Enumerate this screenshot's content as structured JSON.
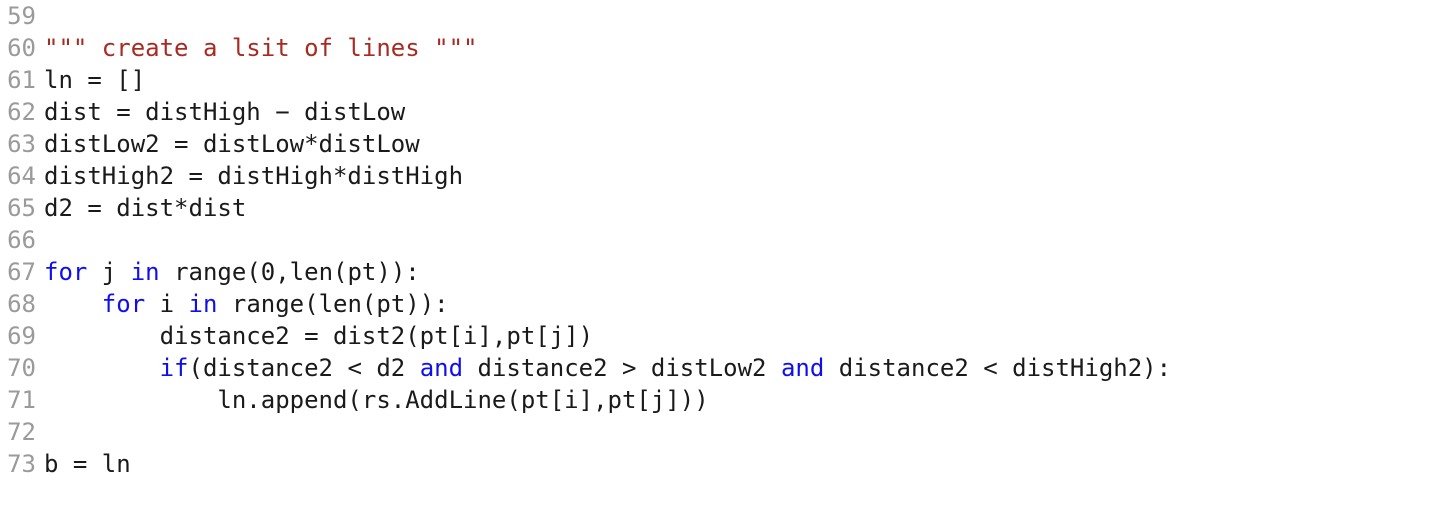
{
  "editor": {
    "language": "Python",
    "background_color": "#ffffff",
    "gutter_color": "#9a9a9a",
    "default_text_color": "#1a1a1a",
    "keyword_color": "#0f0fee",
    "string_color": "#a82b22",
    "font_size_px": 24,
    "line_height_px": 32,
    "first_visible_line": 59,
    "last_visible_line": 73,
    "clipped_top_fragment": "n"
  },
  "lines": [
    {
      "number": "59",
      "text": "",
      "tokens": []
    },
    {
      "number": "60",
      "text": "\"\"\" create a lsit of lines \"\"\"",
      "tokens": [
        {
          "t": "\"\"\" create a lsit of lines \"\"\"",
          "c": "str"
        }
      ]
    },
    {
      "number": "61",
      "text": "ln = []",
      "tokens": [
        {
          "t": "ln = []",
          "c": "plain"
        }
      ]
    },
    {
      "number": "62",
      "text": "dist = distHigh − distLow",
      "tokens": [
        {
          "t": "dist = distHigh − distLow",
          "c": "plain"
        }
      ]
    },
    {
      "number": "63",
      "text": "distLow2 = distLow*distLow",
      "tokens": [
        {
          "t": "distLow2 = distLow*distLow",
          "c": "plain"
        }
      ]
    },
    {
      "number": "64",
      "text": "distHigh2 = distHigh*distHigh",
      "tokens": [
        {
          "t": "distHigh2 = distHigh*distHigh",
          "c": "plain"
        }
      ]
    },
    {
      "number": "65",
      "text": "d2 = dist*dist",
      "tokens": [
        {
          "t": "d2 = dist*dist",
          "c": "plain"
        }
      ]
    },
    {
      "number": "66",
      "text": "",
      "tokens": []
    },
    {
      "number": "67",
      "text": "for j in range(0,len(pt)):",
      "tokens": [
        {
          "t": "for",
          "c": "kw"
        },
        {
          "t": " j ",
          "c": "plain"
        },
        {
          "t": "in",
          "c": "kw"
        },
        {
          "t": " range(0,len(pt)):",
          "c": "plain"
        }
      ]
    },
    {
      "number": "68",
      "text": "    for i in range(len(pt)):",
      "tokens": [
        {
          "t": "    ",
          "c": "plain"
        },
        {
          "t": "for",
          "c": "kw"
        },
        {
          "t": " i ",
          "c": "plain"
        },
        {
          "t": "in",
          "c": "kw"
        },
        {
          "t": " range(len(pt)):",
          "c": "plain"
        }
      ]
    },
    {
      "number": "69",
      "text": "        distance2 = dist2(pt[i],pt[j])",
      "tokens": [
        {
          "t": "        distance2 = dist2(pt[i],pt[j])",
          "c": "plain"
        }
      ]
    },
    {
      "number": "70",
      "text": "        if(distance2 < d2 and distance2 > distLow2 and distance2 < distHigh2):",
      "tokens": [
        {
          "t": "        ",
          "c": "plain"
        },
        {
          "t": "if",
          "c": "kw"
        },
        {
          "t": "(distance2 < d2 ",
          "c": "plain"
        },
        {
          "t": "and",
          "c": "kw"
        },
        {
          "t": " distance2 > distLow2 ",
          "c": "plain"
        },
        {
          "t": "and",
          "c": "kw"
        },
        {
          "t": " distance2 < distHigh2):",
          "c": "plain"
        }
      ]
    },
    {
      "number": "71",
      "text": "            ln.append(rs.AddLine(pt[i],pt[j]))",
      "tokens": [
        {
          "t": "            ln.append(rs.AddLine(pt[i],pt[j]))",
          "c": "plain"
        }
      ]
    },
    {
      "number": "72",
      "text": "",
      "tokens": []
    },
    {
      "number": "73",
      "text": "b = ln",
      "tokens": [
        {
          "t": "b = ln",
          "c": "plain"
        }
      ]
    }
  ]
}
